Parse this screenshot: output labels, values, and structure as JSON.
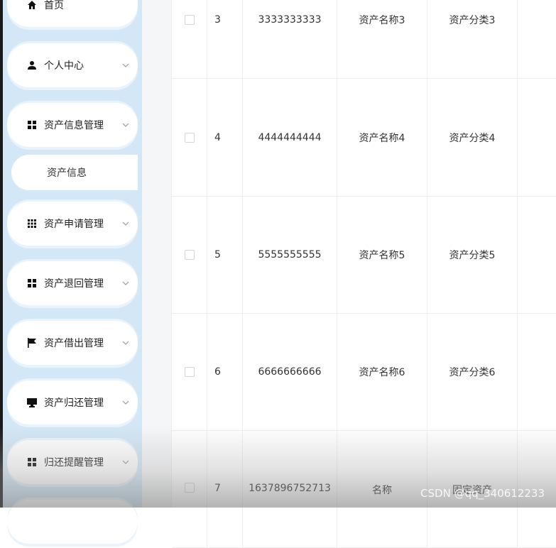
{
  "sidebar": {
    "items": [
      {
        "label": "首页",
        "icon": "home-icon"
      },
      {
        "label": "个人中心",
        "icon": "user-icon"
      },
      {
        "label": "资产信息管理",
        "icon": "grid-icon"
      },
      {
        "label": "资产申请管理",
        "icon": "grid9-icon"
      },
      {
        "label": "资产退回管理",
        "icon": "grid-icon"
      },
      {
        "label": "资产借出管理",
        "icon": "flag-icon"
      },
      {
        "label": "资产归还管理",
        "icon": "monitor-icon"
      },
      {
        "label": "归还提醒管理",
        "icon": "grid-icon"
      }
    ],
    "submenu": {
      "label": "资产信息"
    }
  },
  "table": {
    "rows": [
      {
        "index": "3",
        "number": "3333333333",
        "name": "资产名称3",
        "category": "资产分类3"
      },
      {
        "index": "4",
        "number": "4444444444",
        "name": "资产名称4",
        "category": "资产分类4"
      },
      {
        "index": "5",
        "number": "5555555555",
        "name": "资产名称5",
        "category": "资产分类5"
      },
      {
        "index": "6",
        "number": "6666666666",
        "name": "资产名称6",
        "category": "资产分类6"
      },
      {
        "index": "7",
        "number": "1637896752713",
        "name": "名称",
        "category": "固定资产"
      }
    ]
  },
  "watermark": "CSDN @qq_340612233"
}
